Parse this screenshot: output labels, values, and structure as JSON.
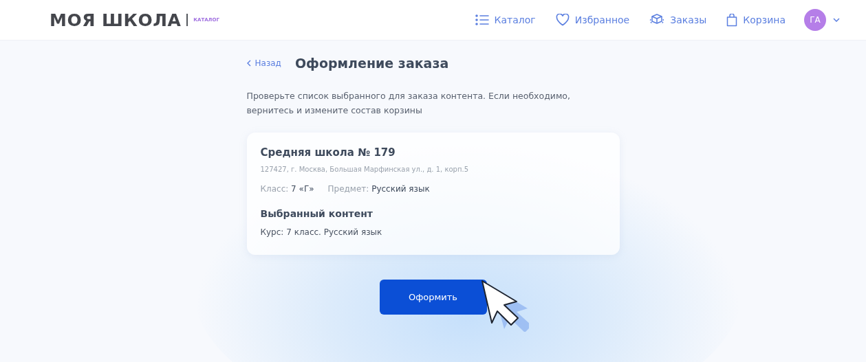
{
  "header": {
    "logo": "МОЯ ШКОЛА",
    "logo_badge": "КАТАЛОГ",
    "nav": [
      {
        "label": "Каталог",
        "kind": "list"
      },
      {
        "label": "Избранное",
        "kind": "heart"
      },
      {
        "label": "Заказы",
        "kind": "box"
      },
      {
        "label": "Корзина",
        "kind": "bag"
      }
    ],
    "avatar": "ГА"
  },
  "back": "Назад",
  "title": "Оформление заказа",
  "description": "Проверьте список выбранного для заказа контента. Если необходимо, вернитесь и измените состав корзины",
  "card": {
    "school": "Средняя школа № 179",
    "address": "127427, г. Москва, Большая Марфинская ул., д. 1, корп.5",
    "fields": [
      {
        "label": "Класс:",
        "value": "7 «Г»"
      },
      {
        "label": "Предмет:",
        "value": "Русский язык"
      }
    ],
    "content_heading": "Выбранный контент",
    "content_item": "Курс: 7 класс. Русский язык"
  },
  "submit": "Оформить"
}
